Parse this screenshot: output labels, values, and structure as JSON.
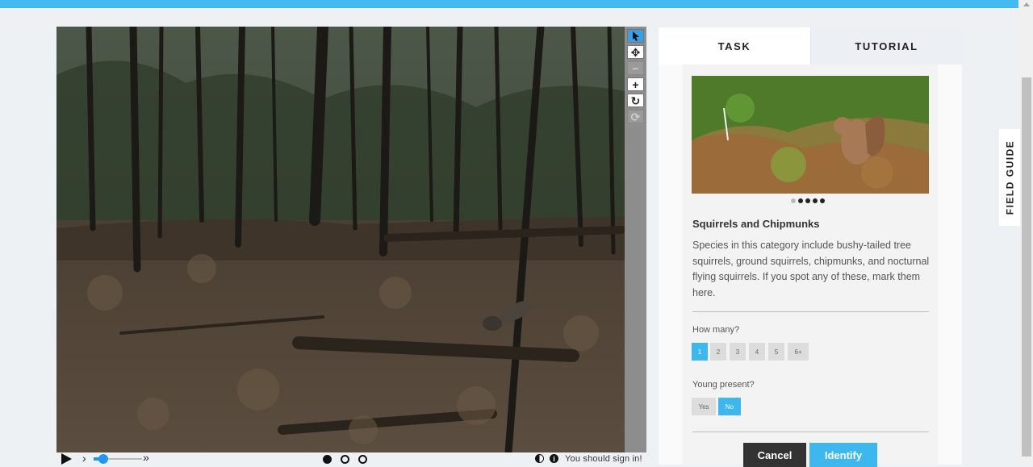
{
  "viewer": {
    "tools": [
      "pointer",
      "move",
      "zoom-out",
      "zoom-in",
      "rotate",
      "reset"
    ],
    "signin_text": "You should sign in!",
    "frame_dots": [
      true,
      false,
      false
    ]
  },
  "panel": {
    "tabs": {
      "task": "TASK",
      "tutorial": "TUTORIAL"
    },
    "species_title": "Squirrels and Chipmunks",
    "description": "Species in this category include bushy-tailed tree squirrels, ground squirrels, chipmunks, and nocturnal flying squirrels. If you spot any of these, mark them here.",
    "how_many_label": "How many?",
    "how_many_options": [
      "1",
      "2",
      "3",
      "4",
      "5",
      "6+"
    ],
    "how_many_selected": "1",
    "young_label": "Young present?",
    "young_options": [
      "Yes",
      "No"
    ],
    "young_selected": "No",
    "cancel_label": "Cancel",
    "identify_label": "Identify",
    "image_count": 5,
    "current_image": 1
  },
  "field_guide_label": "FIELD GUIDE",
  "colors": {
    "accent": "#3db7ee",
    "topbar": "#43bbf0",
    "cancel": "#333333"
  }
}
